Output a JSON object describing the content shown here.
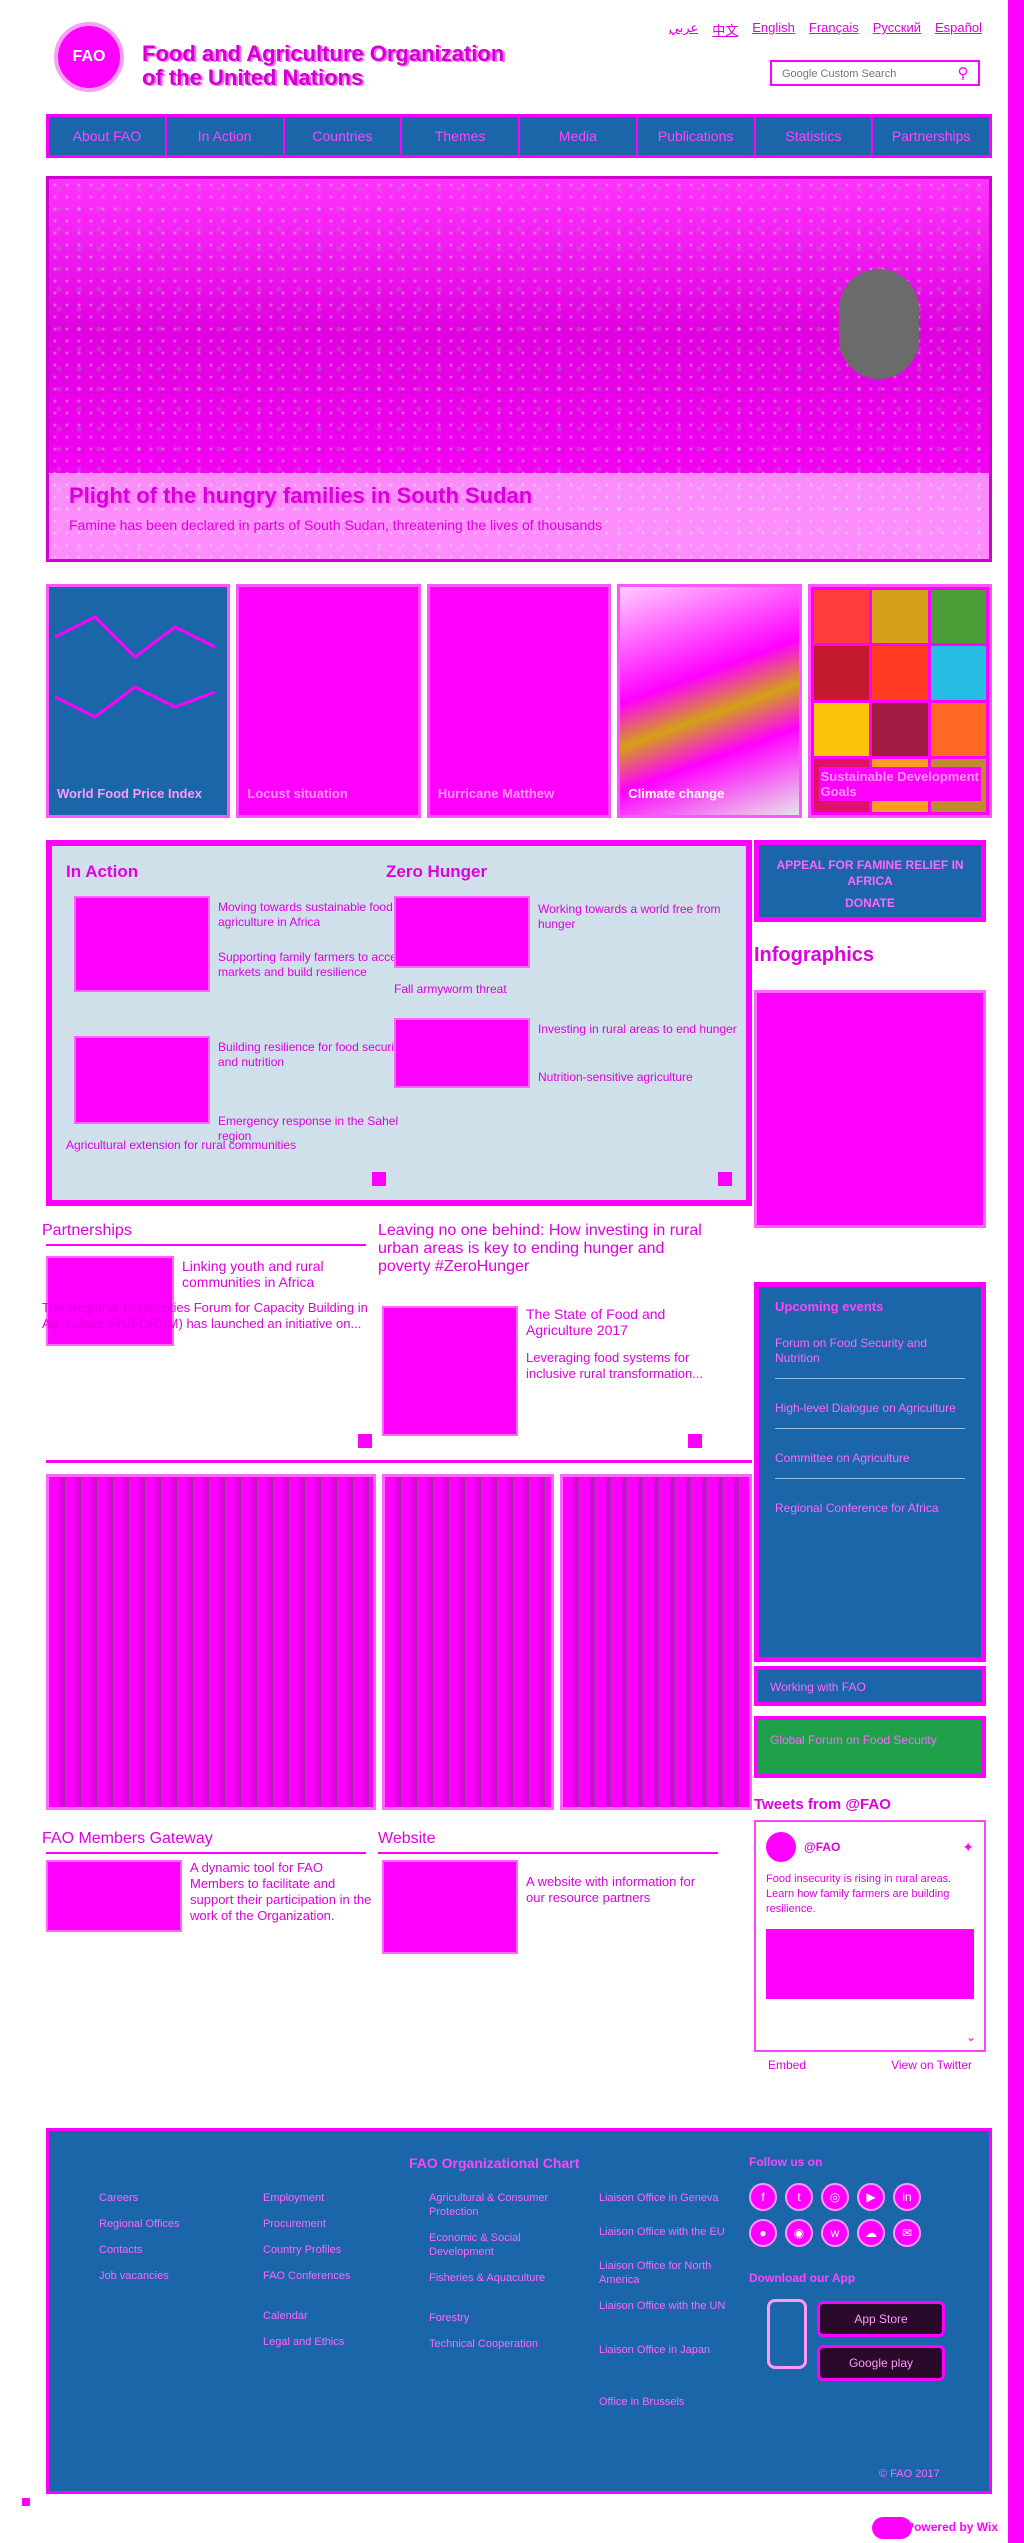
{
  "header": {
    "org_name_line1": "Food and Agriculture Organization",
    "org_name_line2": "of the United Nations",
    "logo_label": "FAO",
    "languages": [
      "عربي",
      "中文",
      "English",
      "Français",
      "Русский",
      "Español"
    ],
    "search_placeholder": "Google Custom Search"
  },
  "nav": [
    "About FAO",
    "In Action",
    "Countries",
    "Themes",
    "Media",
    "Publications",
    "Statistics",
    "Partnerships"
  ],
  "hero": {
    "title": "Plight of the hungry families in South Sudan",
    "subtitle": "Famine has been declared in parts of South Sudan, threatening the lives of thousands"
  },
  "tiles": [
    {
      "caption": "World Food Price Index"
    },
    {
      "caption": "Locust situation"
    },
    {
      "caption": "Hurricane Matthew"
    },
    {
      "caption": "Climate change"
    },
    {
      "caption": "Sustainable Development Goals"
    }
  ],
  "in_action": {
    "heading": "In Action",
    "items": [
      "Moving towards sustainable food and agriculture in Africa",
      "Supporting family farmers to access markets and build resilience",
      "Building resilience for food security and nutrition",
      "Emergency response in the Sahel region",
      "Agricultural extension for rural communities"
    ],
    "footer_text": "Agricultural extension for rural communities"
  },
  "zero_hunger": {
    "heading": "Zero Hunger",
    "items": [
      "Working towards a world free from hunger",
      "Fall armyworm threat",
      "Investing in rural areas to end hunger",
      "Nutrition-sensitive agriculture"
    ]
  },
  "sidebar": {
    "appeal_text": "APPEAL FOR FAMINE RELIEF IN AFRICA",
    "appeal_btn": "DONATE",
    "infographics": "Infographics",
    "events_title": "Upcoming events",
    "events": [
      "Forum on Food Security and Nutrition",
      "High-level Dialogue on Agriculture",
      "Committee on Agriculture",
      "Regional Conference for Africa"
    ],
    "ww_label": "Working with FAO",
    "gf_label": "Global Forum on Food Security",
    "twitter_heading": "Tweets from @FAO",
    "tweet_handle": "@FAO",
    "tweet_text": "Food insecurity is rising in rural areas. Learn how family farmers are building resilience.",
    "embed_label": "Embed",
    "view_label": "View on Twitter"
  },
  "partnerships": {
    "heading": "Partnerships",
    "title": "Linking youth and rural communities in Africa",
    "body": "The Regional Universities Forum for Capacity Building in Agriculture (RUFORUM) has launched an initiative on..."
  },
  "leaving": {
    "heading": "Leaving no one behind: How investing in rural urban areas is key to ending hunger and poverty #ZeroHunger",
    "title": "The State of Food and Agriculture 2017",
    "body": "Leveraging food systems for inclusive rural transformation..."
  },
  "gateway": {
    "heading": "FAO Members Gateway",
    "body": "A dynamic tool for FAO Members to facilitate and support their participation in the work of the Organization."
  },
  "website": {
    "heading": "Website",
    "body": "A website with information for our resource partners"
  },
  "footer": {
    "heading": "FAO Organizational Chart",
    "col1": [
      "Careers",
      "Regional Offices",
      "Contacts",
      "Job vacancies"
    ],
    "col2": [
      "Employment",
      "Procurement",
      "Country Profiles",
      "FAO Conferences",
      "Calendar",
      "Legal and Ethics"
    ],
    "col3": [
      "Agricultural & Consumer Protection",
      "Economic & Social Development",
      "Fisheries & Aquaculture",
      "Forestry",
      "Technical Cooperation"
    ],
    "col4": [
      "Liaison Office in Geneva",
      "Liaison Office with the EU",
      "Liaison Office for North America",
      "Liaison Office with the UN",
      "Liaison Office in Japan"
    ],
    "col4_last": "Office in Brussels",
    "follow_us": "Follow us on",
    "download_app": "Download our App",
    "app_store": "App Store",
    "google_play": "Google play",
    "copyright": "© FAO 2017"
  },
  "powered_by": "Powered by Wix"
}
